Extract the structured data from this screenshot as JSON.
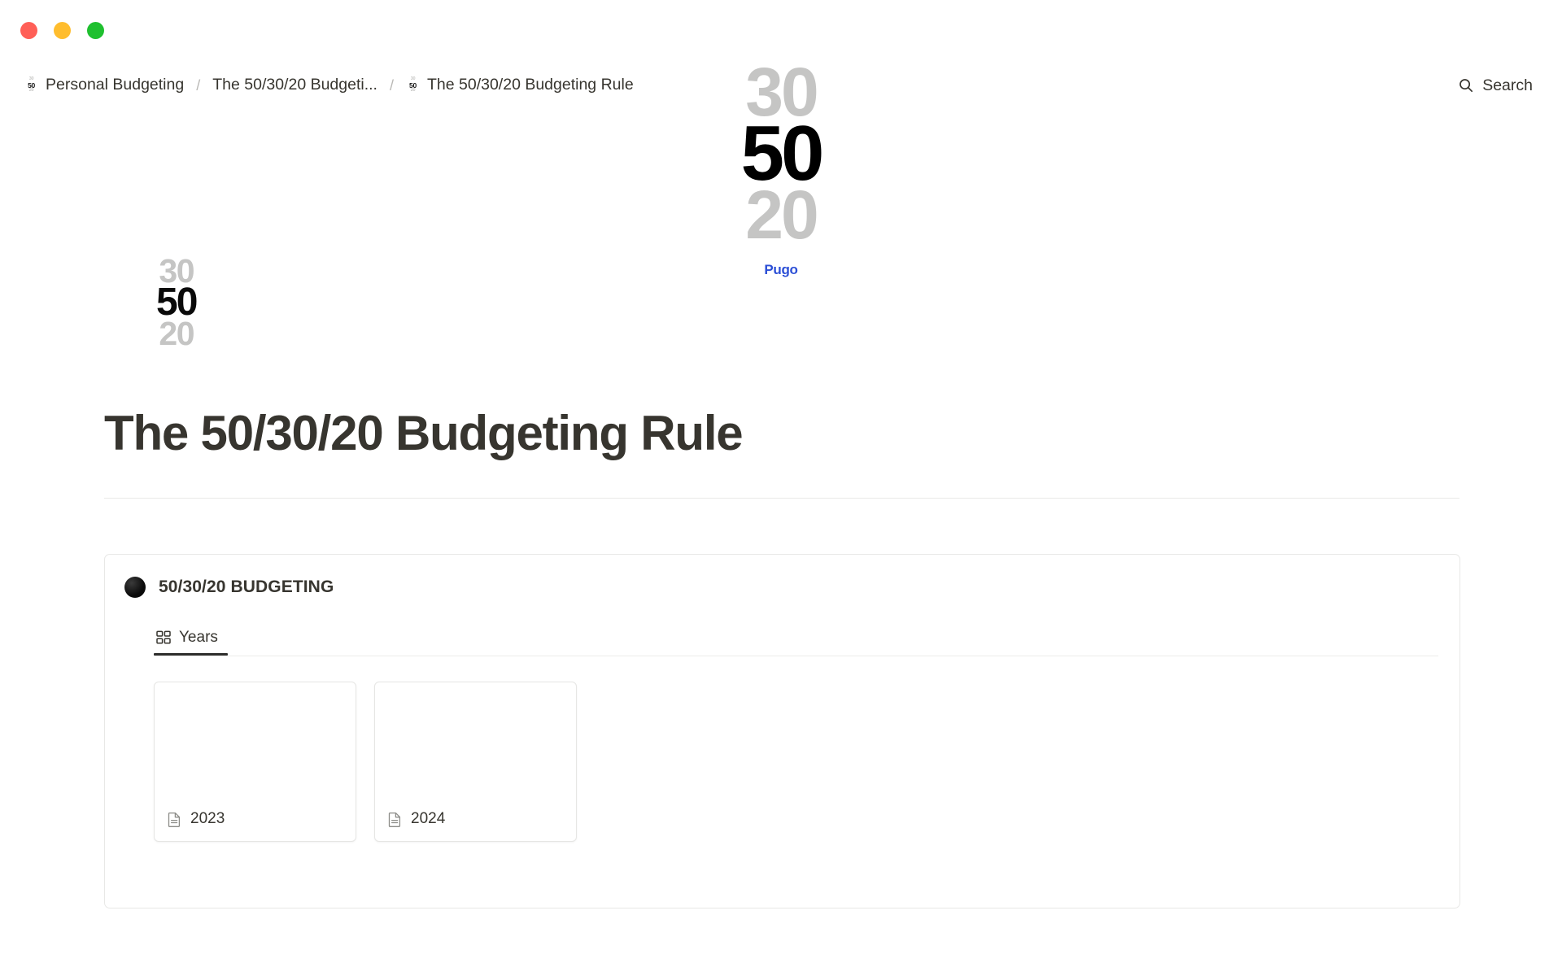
{
  "window": {
    "traffic_lights": [
      {
        "name": "close",
        "color": "#ff5f57"
      },
      {
        "name": "minimize",
        "color": "#ffbd2e"
      },
      {
        "name": "maximize",
        "color": "#1fc02f"
      }
    ]
  },
  "topbar": {
    "breadcrumb": {
      "separator": "/",
      "items": [
        {
          "label": "Personal Budgeting",
          "icon": "budget-5030-20-icon",
          "has_icon": true
        },
        {
          "label": "The 50/30/20 Budgeti...",
          "icon": "",
          "has_icon": false
        },
        {
          "label": "The 50/30/20 Budgeting Rule",
          "icon": "budget-5030-20-icon",
          "has_icon": true
        }
      ]
    },
    "search": {
      "label": "Search",
      "icon": "search-icon"
    }
  },
  "cover": {
    "logo": {
      "top": "30",
      "middle": "50",
      "bottom": "20"
    },
    "brand": "Pugo",
    "brand_color": "#2c4fd6",
    "muted_color": "#c5c5c4",
    "main_color": "#000000"
  },
  "page": {
    "icon": {
      "top": "30",
      "middle": "50",
      "bottom": "20"
    },
    "title": "The 50/30/20 Budgeting Rule"
  },
  "database": {
    "icon": "black-circle-icon",
    "title": "50/30/20 BUDGETING",
    "tabs": [
      {
        "label": "Years",
        "icon": "gallery-view-icon",
        "active": true
      }
    ],
    "cards": [
      {
        "label": "2023",
        "icon": "page-document-icon"
      },
      {
        "label": "2024",
        "icon": "page-document-icon"
      }
    ]
  }
}
